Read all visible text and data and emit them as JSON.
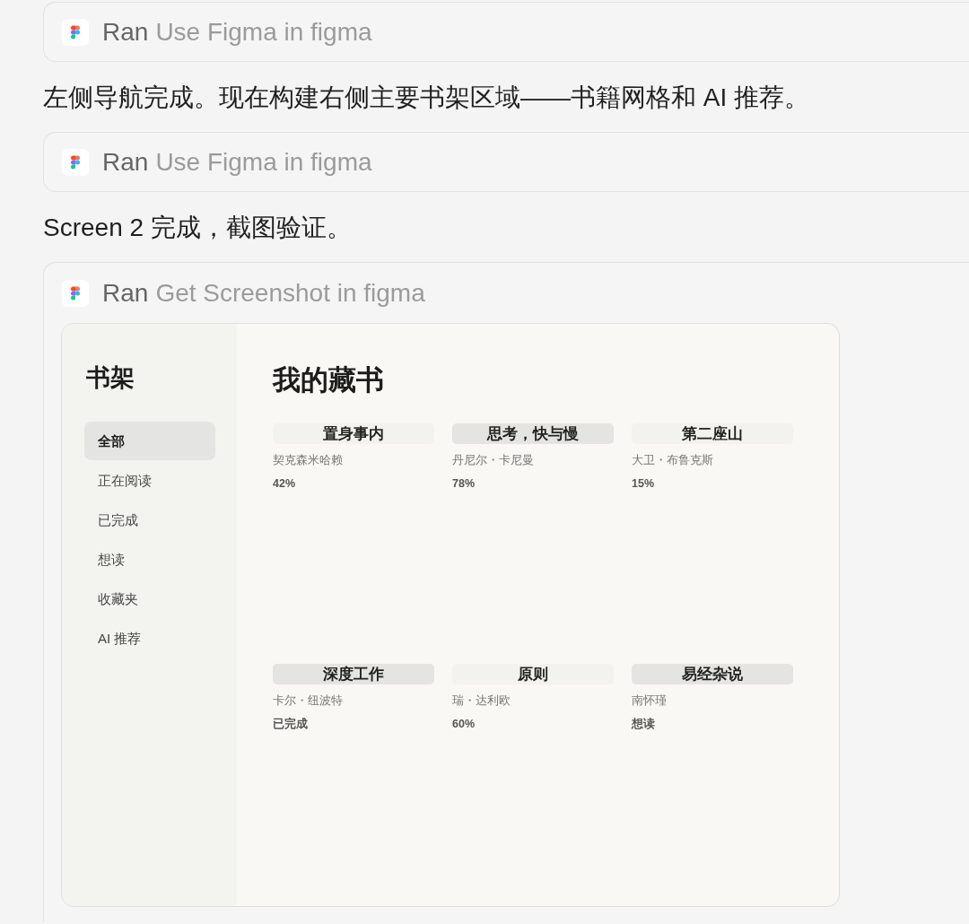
{
  "messages": [
    {
      "kind": "tool",
      "status": "Ran",
      "action": "Use Figma in figma"
    },
    {
      "kind": "text",
      "text": "左侧导航完成。现在构建右侧主要书架区域——书籍网格和 AI 推荐。"
    },
    {
      "kind": "tool",
      "status": "Ran",
      "action": "Use Figma in figma"
    },
    {
      "kind": "text",
      "text": "Screen 2 完成，截图验证。"
    },
    {
      "kind": "tool",
      "status": "Ran",
      "action": "Get Screenshot in figma",
      "screenshot": {
        "sidebar": {
          "title": "书架",
          "items": [
            {
              "label": "全部",
              "selected": true
            },
            {
              "label": "正在阅读",
              "selected": false
            },
            {
              "label": "已完成",
              "selected": false
            },
            {
              "label": "想读",
              "selected": false
            },
            {
              "label": "收藏夹",
              "selected": false
            },
            {
              "label": "AI 推荐",
              "selected": false
            }
          ]
        },
        "title": "我的藏书",
        "books": [
          {
            "title": "置身事内",
            "author": "契克森米哈赖",
            "reading_status": "42%",
            "color": "#f2f2ee"
          },
          {
            "title": "思考，快与慢",
            "author": "丹尼尔・卡尼曼",
            "reading_status": "78%",
            "color": "#e4e4e2"
          },
          {
            "title": "第二座山",
            "author": "大卫・布鲁克斯",
            "reading_status": "15%",
            "color": "#f2f2ee"
          },
          {
            "title": "深度工作",
            "author": "卡尔・纽波特",
            "reading_status": "已完成",
            "color": "#e4e4e2"
          },
          {
            "title": "原则",
            "author": "瑞・达利欧",
            "reading_status": "60%",
            "color": "#f2f2ee"
          },
          {
            "title": "易经杂说",
            "author": "南怀瑾",
            "reading_status": "想读",
            "color": "#e4e4e2"
          }
        ]
      }
    }
  ]
}
